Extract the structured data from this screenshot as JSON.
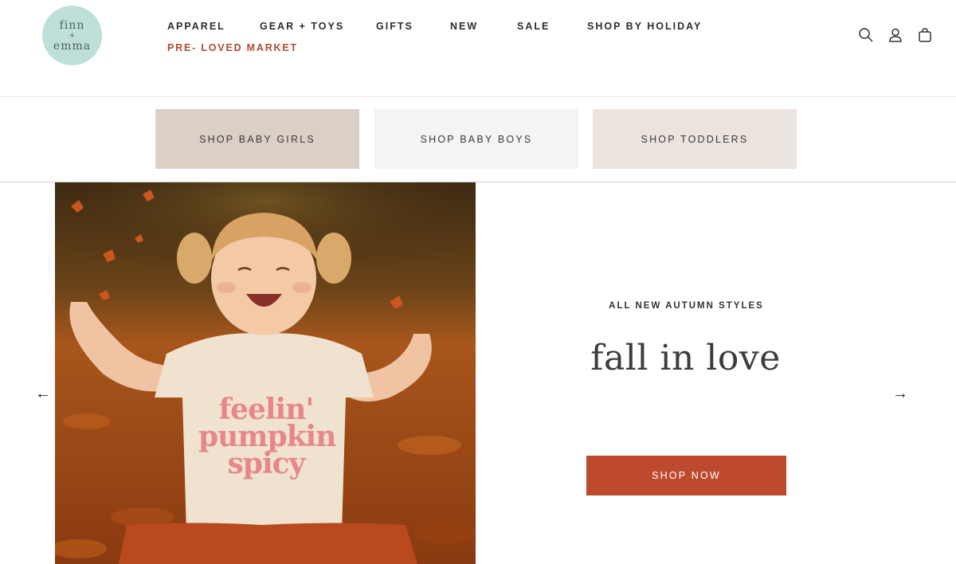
{
  "logo": {
    "line1": "finn",
    "plus": "+",
    "line2": "emma"
  },
  "nav": {
    "items": [
      "APPAREL",
      "GEAR + TOYS",
      "GIFTS",
      "NEW",
      "SALE",
      "SHOP BY HOLIDAY"
    ],
    "secondary": "PRE- LOVED MARKET"
  },
  "header_icons": [
    "search-icon",
    "account-icon",
    "cart-icon"
  ],
  "categories": [
    {
      "label": "SHOP BABY GIRLS",
      "bg": "#dccfc8"
    },
    {
      "label": "SHOP BABY BOYS",
      "bg": "#f4f4f4"
    },
    {
      "label": "SHOP TODDLERS",
      "bg": "#ebe3de"
    }
  ],
  "hero": {
    "eyebrow": "ALL NEW AUTUMN STYLES",
    "headline": "fall in love",
    "cta": "SHOP NOW",
    "prev_arrow": "←",
    "next_arrow": "→",
    "shirt_text": [
      "feelin'",
      "pumpkin",
      "spicy"
    ]
  },
  "colors": {
    "accent": "#bd4a2f",
    "logo_bg": "#bfe0da",
    "nav_accent": "#b34a2e"
  }
}
